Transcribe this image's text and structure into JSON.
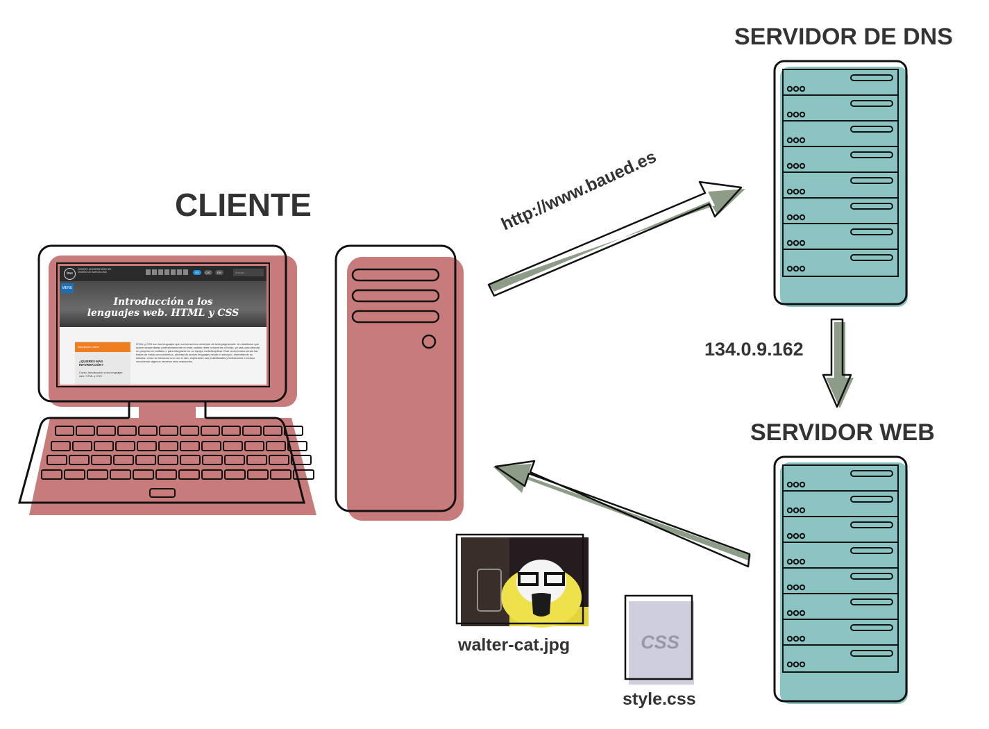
{
  "client": {
    "title": "CLIENTE"
  },
  "dns_server": {
    "title": "SERVIDOR DE DNS"
  },
  "web_server": {
    "title": "SERVIDOR WEB"
  },
  "request": {
    "url": "http://www.baued.es"
  },
  "dns_response": {
    "ip": "134.0.9.162"
  },
  "files": {
    "image": {
      "name": "walter-cat.jpg"
    },
    "stylesheet": {
      "name": "style.css",
      "icon_text": "CSS"
    }
  },
  "screen": {
    "logo": "bau",
    "org_name": "CENTRO UNIVERSITARIO DE DISEÑO DE BARCELONA",
    "menu": "MENU",
    "langs": [
      "ES",
      "CAT",
      "EN"
    ],
    "search": "Buscar...",
    "hero_title_1": "Introducción a los",
    "hero_title_2": "lenguajes web. HTML y CSS",
    "sidebar_button": "Inscripción online",
    "sidebar_heading": "¿QUIERES MÁS INFORMACIÓN?",
    "sidebar_text": "Curso: Introducción a los lenguajes web. HTML y CSS",
    "body_text": "HTML y CSS son los lenguajes que conforman los cimientos de toda página web. Un diseñador que quiere desarrollarse profesionalmente en este camino debe conocerlos a fondo, ya sea para abordar un proyecto en solitario o para integrarse en un equipo multidisciplinar. Este curso busca sentar las bases de estos conocimientos, abordando ambos lenguajes desde el principio, entendiendo su sintaxis, cómo se relaciona uno con el otro, explorando sus posibilidades y limitaciones e incluso conociendo algunos secretos más avanzados."
  },
  "colors": {
    "client_fill": "#c77b7a",
    "server_fill": "#8cc3c3",
    "arrow_fill": "#8d9c86",
    "outline": "#111111",
    "css_file_fill": "#cfcedc"
  }
}
